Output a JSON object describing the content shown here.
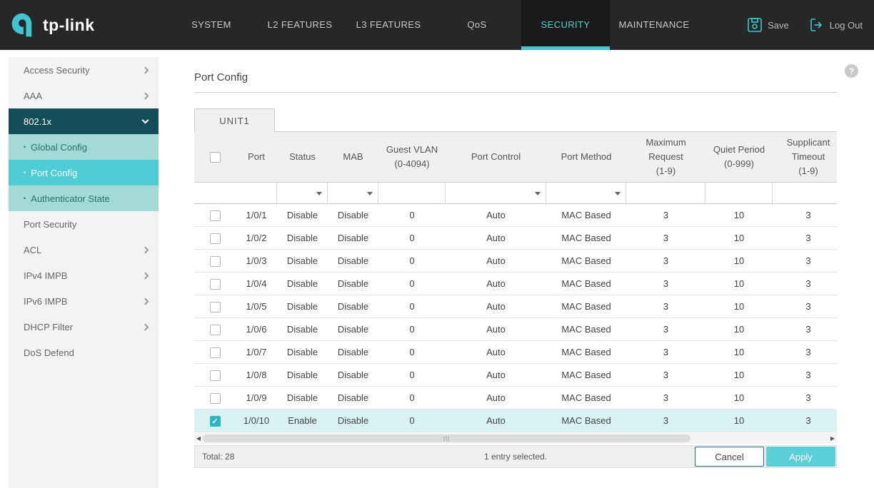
{
  "topbar": {
    "brand": "tp-link",
    "nav": [
      {
        "label": "SYSTEM"
      },
      {
        "label": "L2 FEATURES"
      },
      {
        "label": "L3 FEATURES"
      },
      {
        "label": "QoS"
      },
      {
        "label": "SECURITY",
        "active": true
      },
      {
        "label": "MAINTENANCE"
      }
    ],
    "save_label": "Save",
    "logout_label": "Log Out"
  },
  "sidebar": {
    "items": [
      {
        "label": "Access Security",
        "chevron": "right"
      },
      {
        "label": "AAA",
        "chevron": "right"
      },
      {
        "label": "802.1x",
        "chevron": "down",
        "active": true
      },
      {
        "label": "Global Config",
        "sub": true
      },
      {
        "label": "Port Config",
        "sub": true,
        "active": true
      },
      {
        "label": "Authenticator State",
        "sub": true
      },
      {
        "label": "Port Security"
      },
      {
        "label": "ACL",
        "chevron": "right"
      },
      {
        "label": "IPv4 IMPB",
        "chevron": "right"
      },
      {
        "label": "IPv6 IMPB",
        "chevron": "right"
      },
      {
        "label": "DHCP Filter",
        "chevron": "right"
      },
      {
        "label": "DoS Defend"
      }
    ]
  },
  "main": {
    "title": "Port Config",
    "help_glyph": "?",
    "tab_label": "UNIT1",
    "accent_color": "#3fc6d0",
    "table": {
      "headers": [
        "Port",
        "Status",
        "MAB",
        "Guest VLAN\n(0-4094)",
        "Port Control",
        "Port Method",
        "Maximum\nRequest\n(1-9)",
        "Quiet Period\n(0-999)",
        "Supplicant\nTimeout\n(1-9)"
      ],
      "filter_cells": [
        {
          "type": "empty"
        },
        {
          "type": "select"
        },
        {
          "type": "select"
        },
        {
          "type": "input"
        },
        {
          "type": "select"
        },
        {
          "type": "select"
        },
        {
          "type": "input"
        },
        {
          "type": "input"
        },
        {
          "type": "input"
        }
      ],
      "rows": [
        {
          "port": "1/0/1",
          "status": "Disable",
          "mab": "Disable",
          "guest_vlan": "0",
          "port_control": "Auto",
          "port_method": "MAC Based",
          "max_request": "3",
          "quiet_period": "10",
          "supplicant_timeout": "3"
        },
        {
          "port": "1/0/2",
          "status": "Disable",
          "mab": "Disable",
          "guest_vlan": "0",
          "port_control": "Auto",
          "port_method": "MAC Based",
          "max_request": "3",
          "quiet_period": "10",
          "supplicant_timeout": "3"
        },
        {
          "port": "1/0/3",
          "status": "Disable",
          "mab": "Disable",
          "guest_vlan": "0",
          "port_control": "Auto",
          "port_method": "MAC Based",
          "max_request": "3",
          "quiet_period": "10",
          "supplicant_timeout": "3"
        },
        {
          "port": "1/0/4",
          "status": "Disable",
          "mab": "Disable",
          "guest_vlan": "0",
          "port_control": "Auto",
          "port_method": "MAC Based",
          "max_request": "3",
          "quiet_period": "10",
          "supplicant_timeout": "3"
        },
        {
          "port": "1/0/5",
          "status": "Disable",
          "mab": "Disable",
          "guest_vlan": "0",
          "port_control": "Auto",
          "port_method": "MAC Based",
          "max_request": "3",
          "quiet_period": "10",
          "supplicant_timeout": "3"
        },
        {
          "port": "1/0/6",
          "status": "Disable",
          "mab": "Disable",
          "guest_vlan": "0",
          "port_control": "Auto",
          "port_method": "MAC Based",
          "max_request": "3",
          "quiet_period": "10",
          "supplicant_timeout": "3"
        },
        {
          "port": "1/0/7",
          "status": "Disable",
          "mab": "Disable",
          "guest_vlan": "0",
          "port_control": "Auto",
          "port_method": "MAC Based",
          "max_request": "3",
          "quiet_period": "10",
          "supplicant_timeout": "3"
        },
        {
          "port": "1/0/8",
          "status": "Disable",
          "mab": "Disable",
          "guest_vlan": "0",
          "port_control": "Auto",
          "port_method": "MAC Based",
          "max_request": "3",
          "quiet_period": "10",
          "supplicant_timeout": "3"
        },
        {
          "port": "1/0/9",
          "status": "Disable",
          "mab": "Disable",
          "guest_vlan": "0",
          "port_control": "Auto",
          "port_method": "MAC Based",
          "max_request": "3",
          "quiet_period": "10",
          "supplicant_timeout": "3"
        },
        {
          "port": "1/0/10",
          "status": "Enable",
          "mab": "Disable",
          "guest_vlan": "0",
          "port_control": "Auto",
          "port_method": "MAC Based",
          "max_request": "3",
          "quiet_period": "10",
          "supplicant_timeout": "3",
          "selected": true
        }
      ]
    },
    "footer": {
      "total": "Total: 28",
      "selected": "1 entry selected.",
      "cancel": "Cancel",
      "apply": "Apply"
    }
  }
}
